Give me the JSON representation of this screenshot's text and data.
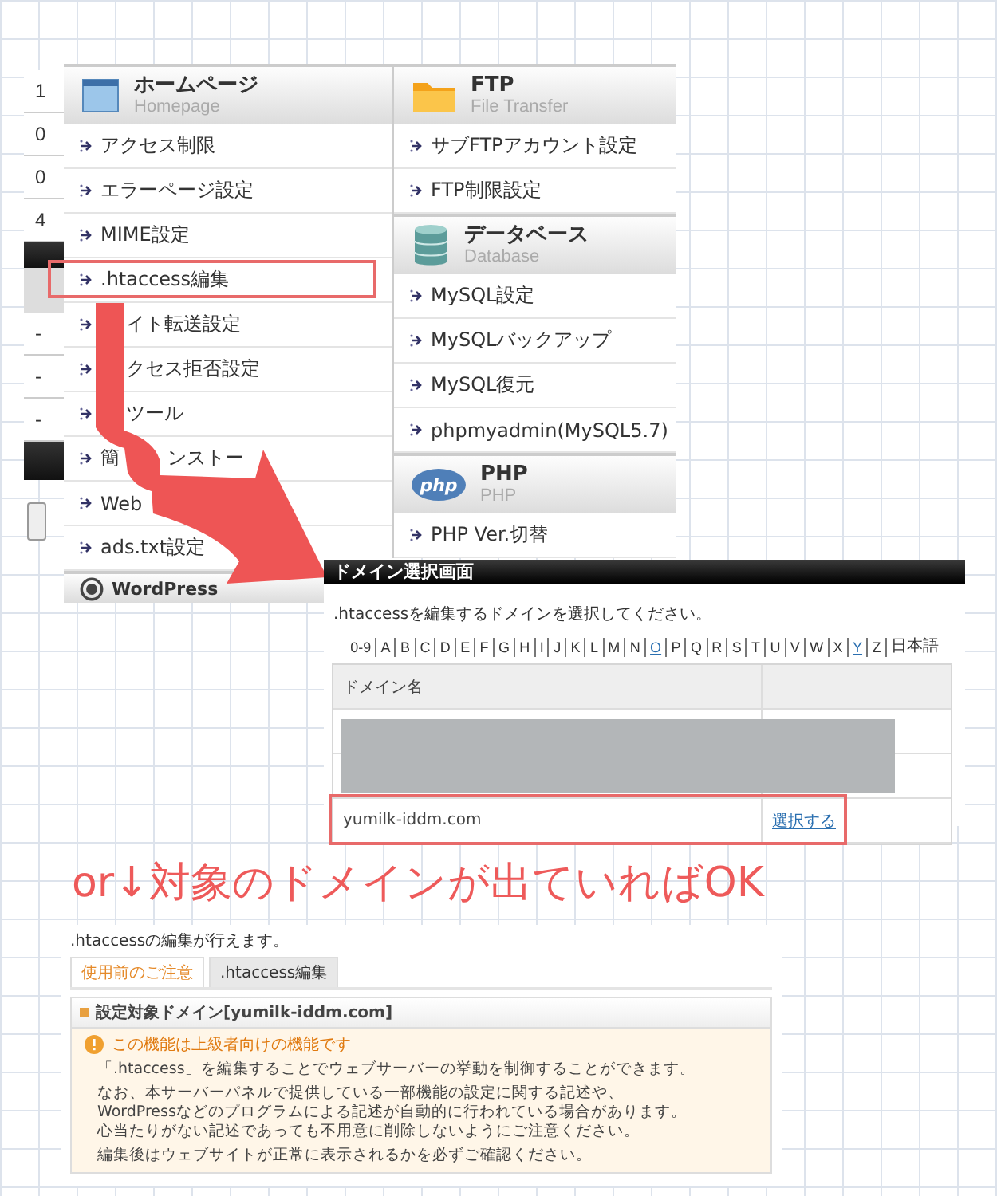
{
  "side_strip": {
    "numbers": [
      "1",
      "0",
      "0",
      "4"
    ],
    "dashes": [
      "-",
      "-",
      "-"
    ]
  },
  "menu": {
    "columns": [
      {
        "sections": [
          {
            "kind": "window",
            "title": "ホームページ",
            "subtitle": "Homepage",
            "items": [
              {
                "parts": [
                  "アクセス制限"
                ],
                "highlighted": false
              },
              {
                "parts": [
                  "エラーページ設定"
                ],
                "highlighted": false
              },
              {
                "parts": [
                  "MIME設定"
                ],
                "highlighted": false
              },
              {
                "parts": [
                  ".htaccess編集"
                ],
                "highlighted": true
              },
              {
                "parts": [
                  "イト転送設定"
                ],
                "lead_hidden": true,
                "highlighted": false
              },
              {
                "parts": [
                  "クセス拒否設定"
                ],
                "lead_hidden": true,
                "highlighted": false
              },
              {
                "parts": [
                  "ツール"
                ],
                "lead_hidden": true,
                "highlighted": false
              },
              {
                "parts": [
                  "簡",
                  "ンストー"
                ],
                "highlighted": false
              },
              {
                "parts": [
                  "Web"
                ],
                "highlighted": false
              },
              {
                "parts": [
                  "ads.txt設定"
                ],
                "highlighted": false
              }
            ]
          },
          {
            "kind": "wordpress",
            "title": "WordPress"
          }
        ]
      },
      {
        "sections": [
          {
            "kind": "folder",
            "title": "FTP",
            "subtitle": "File Transfer",
            "items": [
              {
                "parts": [
                  "サブFTPアカウント設定"
                ],
                "highlighted": false
              },
              {
                "parts": [
                  "FTP制限設定"
                ],
                "highlighted": false
              }
            ]
          },
          {
            "kind": "database",
            "title": "データベース",
            "subtitle": "Database",
            "items": [
              {
                "parts": [
                  "MySQL設定"
                ],
                "highlighted": false
              },
              {
                "parts": [
                  "MySQLバックアップ"
                ],
                "highlighted": false
              },
              {
                "parts": [
                  "MySQL復元"
                ],
                "highlighted": false
              },
              {
                "parts": [
                  "phpmyadmin(MySQL5.7)"
                ],
                "highlighted": false
              }
            ]
          },
          {
            "kind": "php",
            "icon_text": "php",
            "title": "PHP",
            "subtitle": "PHP",
            "items": [
              {
                "parts": [
                  "PHP Ver.切替"
                ],
                "highlighted": false
              }
            ]
          }
        ]
      }
    ]
  },
  "domain_panel": {
    "title": "ドメイン選択画面",
    "instruction": ".htaccessを編集するドメインを選択してください。",
    "index": [
      {
        "label": "0-9",
        "linked": false
      },
      {
        "label": "A",
        "linked": false
      },
      {
        "label": "B",
        "linked": false
      },
      {
        "label": "C",
        "linked": false
      },
      {
        "label": "D",
        "linked": false
      },
      {
        "label": "E",
        "linked": false
      },
      {
        "label": "F",
        "linked": false
      },
      {
        "label": "G",
        "linked": false
      },
      {
        "label": "H",
        "linked": false
      },
      {
        "label": "I",
        "linked": false
      },
      {
        "label": "J",
        "linked": false
      },
      {
        "label": "K",
        "linked": false
      },
      {
        "label": "L",
        "linked": false
      },
      {
        "label": "M",
        "linked": false
      },
      {
        "label": "N",
        "linked": false
      },
      {
        "label": "O",
        "linked": true
      },
      {
        "label": "P",
        "linked": false
      },
      {
        "label": "Q",
        "linked": false
      },
      {
        "label": "R",
        "linked": false
      },
      {
        "label": "S",
        "linked": false
      },
      {
        "label": "T",
        "linked": false
      },
      {
        "label": "U",
        "linked": false
      },
      {
        "label": "V",
        "linked": false
      },
      {
        "label": "W",
        "linked": false
      },
      {
        "label": "X",
        "linked": false
      },
      {
        "label": "Y",
        "linked": true
      },
      {
        "label": "Z",
        "linked": false
      },
      {
        "label": "日本語",
        "linked": false
      }
    ],
    "table": {
      "columns": [
        "ドメイン名"
      ],
      "rows": [
        {
          "kind": "redacted"
        },
        {
          "kind": "redacted"
        },
        {
          "kind": "domain",
          "domain": "yumilk-iddm.com",
          "action": "選択する",
          "highlighted": true
        }
      ]
    }
  },
  "headline": "or↓対象のドメインが出ていればOK",
  "editor_panel": {
    "intro": ".htaccessの編集が行えます。",
    "tabs": [
      {
        "label": "使用前のご注意",
        "selected": true
      },
      {
        "label": ".htaccess編集",
        "selected": false
      }
    ],
    "box_title": "設定対象ドメイン[yumilk-iddm.com]",
    "warning": "この機能は上級者向けの機能です",
    "paragraphs": [
      [
        "「.htaccess」を編集することでウェブサーバーの挙動を制御することができます。"
      ],
      [
        "なお、本サーバーパネルで提供している一部機能の設定に関する記述や、",
        "WordPressなどのプログラムによる記述が自動的に行われている場合があります。",
        "心当たりがない記述であっても不用意に削除しないようにご注意ください。"
      ],
      [
        "編集後はウェブサイトが正常に表示されるかを必ずご確認ください。"
      ]
    ]
  }
}
